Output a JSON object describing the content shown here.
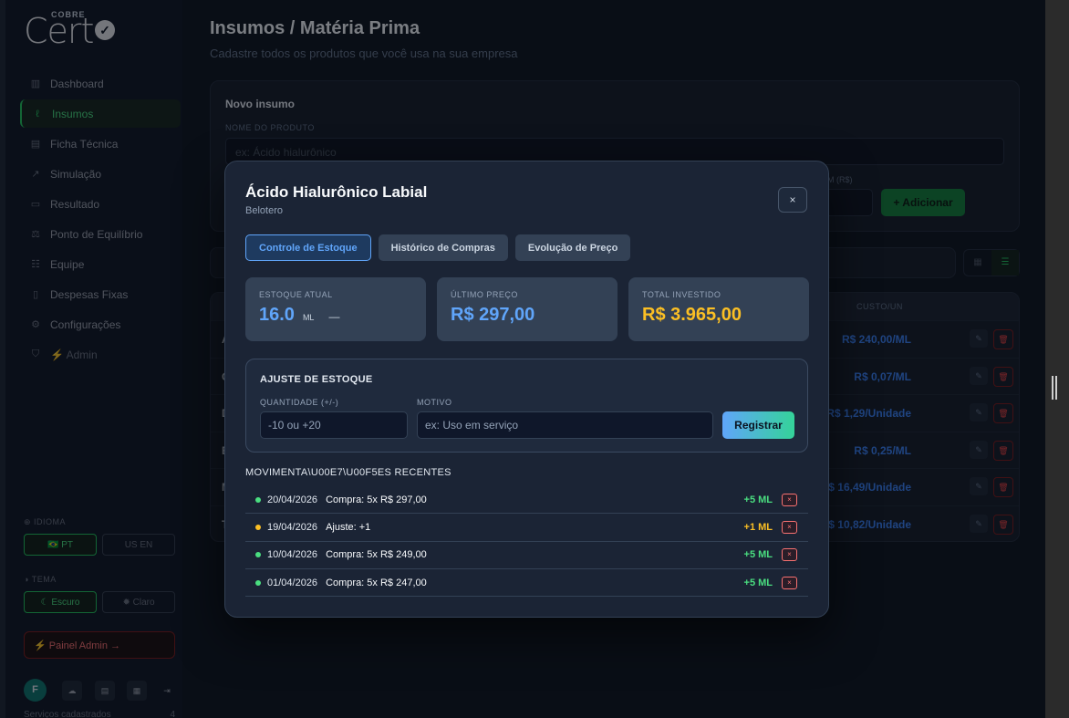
{
  "app": {
    "logo_small": "COBRE",
    "logo_main": "Cert",
    "nav": [
      {
        "label": "Dashboard",
        "icon": "bar-chart-icon"
      },
      {
        "label": "Insumos",
        "icon": "flask-icon",
        "active": true
      },
      {
        "label": "Ficha Técnica",
        "icon": "clipboard-icon"
      },
      {
        "label": "Simulação",
        "icon": "trend-icon"
      },
      {
        "label": "Resultado",
        "icon": "document-icon"
      },
      {
        "label": "Ponto de Equilíbrio",
        "icon": "scale-icon"
      },
      {
        "label": "Equipe",
        "icon": "team-icon"
      },
      {
        "label": "Despesas Fixas",
        "icon": "receipt-icon"
      },
      {
        "label": "Configurações",
        "icon": "gear-icon"
      },
      {
        "label": "⚡ Admin",
        "icon": "shield-icon"
      }
    ],
    "language_label": "IDIOMA",
    "lang_pt": "PT",
    "lang_en": "EN",
    "theme_label": "TEMA",
    "theme_dark": "Escuro",
    "theme_light": "Claro",
    "admin_panel": "⚡ Painel Admin →",
    "avatar_initial": "F",
    "services_label": "Serviços cadastrados",
    "services_count": "4"
  },
  "page": {
    "title": "Insumos / Matéria Prima",
    "subtitle": "Cadastre todos os produtos que você usa na sua empresa",
    "new_card_title": "Novo insumo",
    "product_name_label": "NOME DO PRODUTO",
    "product_name_placeholder": "ex: Ácido hialurônico",
    "price_label": "M (R$)",
    "add_button": "+ Adicionar",
    "cost_column": "CUSTO/UN",
    "rows": [
      {
        "initial": "Á",
        "price": "R$ 240,00/ML"
      },
      {
        "initial": "C",
        "price": "R$ 0,07/ML"
      },
      {
        "initial": "D",
        "price": "R$ 1,29/Unidade"
      },
      {
        "initial": "E",
        "price": "R$ 0,25/ML"
      },
      {
        "initial": "M",
        "price": "R$ 16,49/Unidade"
      },
      {
        "initial": "T",
        "price": "R$ 10,82/Unidade"
      }
    ]
  },
  "modal": {
    "title": "Ácido Hialurônico Labial",
    "subtitle": "Belotero",
    "close": "×",
    "tabs": [
      "Controle de Estoque",
      "Histórico de Compras",
      "Evolução de Preço"
    ],
    "stats": {
      "stock_label": "ESTOQUE ATUAL",
      "stock_value": "16.0",
      "stock_unit": "ML",
      "stock_extra": "—",
      "last_price_label": "ÚLTIMO PREÇO",
      "last_price_value": "R$ 297,00",
      "total_label": "TOTAL INVESTIDO",
      "total_value": "R$ 3.965,00"
    },
    "adjust": {
      "title": "AJUSTE DE ESTOQUE",
      "qty_label": "QUANTIDADE (+/-)",
      "qty_placeholder": "-10 ou +20",
      "reason_label": "MOTIVO",
      "reason_placeholder": "ex: Uso em serviço",
      "submit": "Registrar"
    },
    "movements_title": "MOVIMENTA\\U00E7\\U00F5ES RECENTES",
    "movements": [
      {
        "date": "20/04/2026",
        "desc": "Compra: 5x R$ 297,00",
        "qty": "+5 ML",
        "color": "#4ade80"
      },
      {
        "date": "19/04/2026",
        "desc": "Ajuste: +1",
        "qty": "+1 ML",
        "color": "#fbbf24"
      },
      {
        "date": "10/04/2026",
        "desc": "Compra: 5x R$ 249,00",
        "qty": "+5 ML",
        "color": "#4ade80"
      },
      {
        "date": "01/04/2026",
        "desc": "Compra: 5x R$ 247,00",
        "qty": "+5 ML",
        "color": "#4ade80"
      }
    ],
    "delete_glyph": "×"
  },
  "colors": {
    "accent_blue": "#60a5fa",
    "accent_green": "#22c55e",
    "stat_blue": "#60a5fa",
    "stat_orange": "#fbbf24",
    "danger": "#f87171"
  }
}
